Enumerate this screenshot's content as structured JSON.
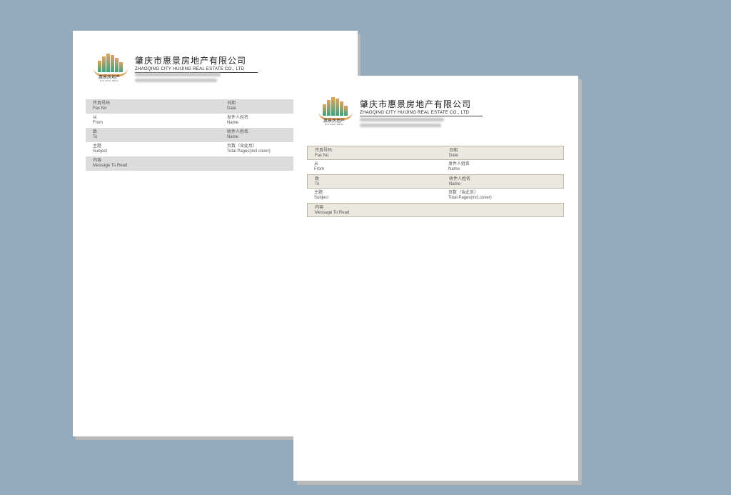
{
  "sheets": [
    {
      "company": {
        "name_cn": "肇庆市惠景房地产有限公司",
        "name_en": "ZHAOQING CITY HUIJING REAL ESTATE CO., LTD",
        "logo_cn": "惠景房地产",
        "logo_en": "HUIJING REAL"
      },
      "rows": [
        {
          "c1_cn": "传真号码",
          "c1_en": "Fax No",
          "c2_cn": "日期",
          "c2_en": "Date",
          "shaded": true
        },
        {
          "c1_cn": "从",
          "c1_en": "From",
          "c2_cn": "发件人姓名",
          "c2_en": "Name",
          "shaded": false
        },
        {
          "c1_cn": "致",
          "c1_en": "To",
          "c2_cn": "收件人姓名",
          "c2_en": "Name",
          "shaded": true
        },
        {
          "c1_cn": "主题",
          "c1_en": "Subject",
          "c2_cn": "页数（含此页）",
          "c2_en": "Total Pages(incl.cover)",
          "shaded": false
        },
        {
          "c1_cn": "内容",
          "c1_en": "Message To Read",
          "c2_cn": "",
          "c2_en": "",
          "shaded": true
        }
      ]
    },
    {
      "company": {
        "name_cn": "肇庆市惠景房地产有限公司",
        "name_en": "ZHAOQING CITY HUIJING REAL ESTATE CO., LTD",
        "logo_cn": "惠景房地产",
        "logo_en": "HUIJING REAL"
      },
      "rows": [
        {
          "c1_cn": "传真号码",
          "c1_en": "Fax No",
          "c2_cn": "日期",
          "c2_en": "Date",
          "shaded": true
        },
        {
          "c1_cn": "从",
          "c1_en": "From",
          "c2_cn": "发件人姓名",
          "c2_en": "Name",
          "shaded": false
        },
        {
          "c1_cn": "致",
          "c1_en": "To",
          "c2_cn": "收件人姓名",
          "c2_en": "Name",
          "shaded": true
        },
        {
          "c1_cn": "主题",
          "c1_en": "Subject",
          "c2_cn": "页数（含此页）",
          "c2_en": "Total Pages(incl.cover)",
          "shaded": false
        },
        {
          "c1_cn": "内容",
          "c1_en": "Message To Read",
          "c2_cn": "",
          "c2_en": "",
          "shaded": true
        }
      ]
    }
  ],
  "colors": {
    "background": "#94abbd",
    "sheet1_shade": "#dcdcdc",
    "sheet2_shade": "#ebe8df",
    "logo_orange": "#e0a15b",
    "logo_green": "#3aa37e"
  }
}
